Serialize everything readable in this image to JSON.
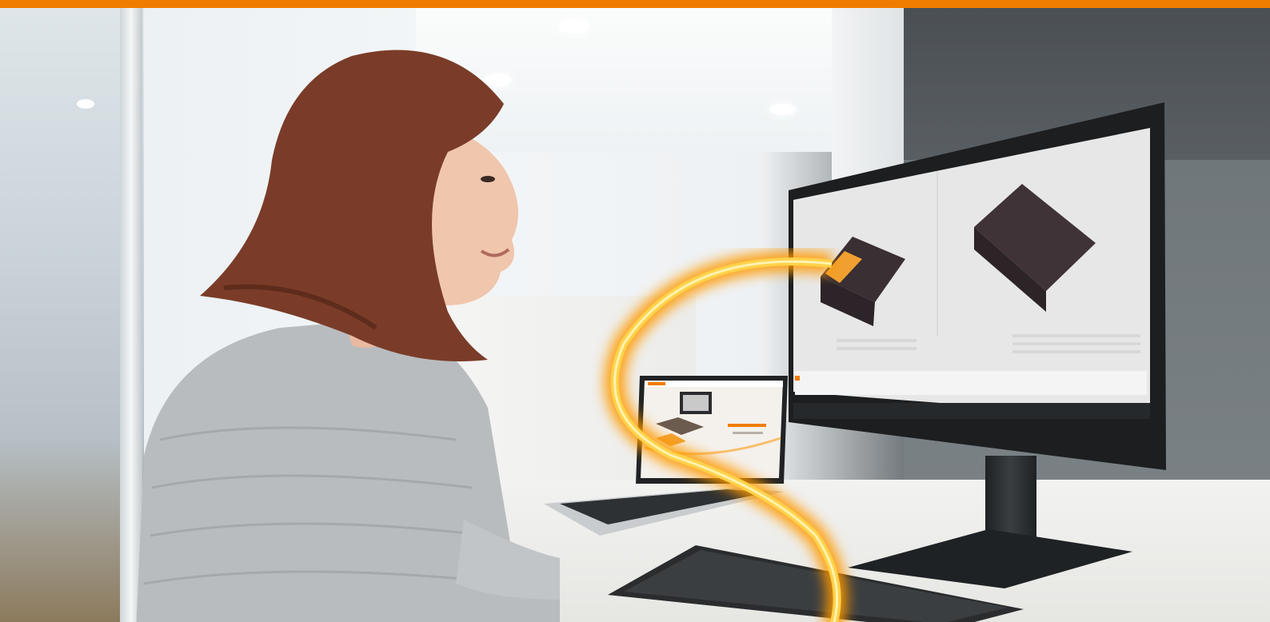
{
  "image": {
    "colors": {
      "accent_strip": "#f07d00",
      "glow": "#ffb000",
      "monitor_bezel": "#1c1e20",
      "screen_bg": "#e7e7e7",
      "part_dark": "#3a2f33"
    },
    "icons": [
      "woman-figure",
      "monitor",
      "laptop",
      "keyboard",
      "glow-swirl"
    ]
  }
}
